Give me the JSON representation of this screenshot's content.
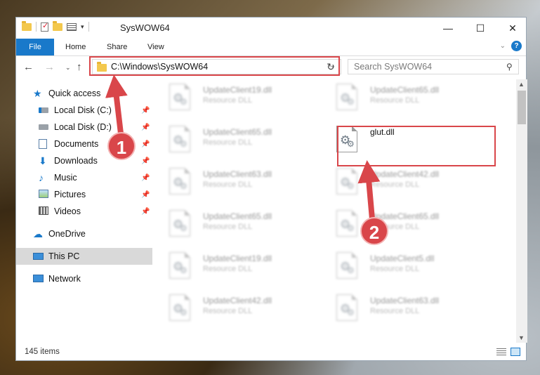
{
  "window": {
    "title": "SysWOW64",
    "controls": {
      "minimize": "—",
      "maximize": "☐",
      "close": "✕"
    }
  },
  "ribbon": {
    "tabs": [
      "File",
      "Home",
      "Share",
      "View"
    ],
    "help": "?"
  },
  "address": {
    "path": "C:\\Windows\\SysWOW64",
    "search_placeholder": "Search SysWOW64"
  },
  "sidebar": {
    "items": [
      {
        "label": "Quick access",
        "icon": "star-icon"
      },
      {
        "label": "Local Disk (C:)",
        "icon": "drive-icon",
        "pinned": true
      },
      {
        "label": "Local Disk (D:)",
        "icon": "drive-icon",
        "pinned": true
      },
      {
        "label": "Documents",
        "icon": "documents-icon",
        "pinned": true
      },
      {
        "label": "Downloads",
        "icon": "download-icon",
        "pinned": true
      },
      {
        "label": "Music",
        "icon": "music-icon",
        "pinned": true
      },
      {
        "label": "Pictures",
        "icon": "pictures-icon",
        "pinned": true
      },
      {
        "label": "Videos",
        "icon": "videos-icon",
        "pinned": true
      },
      {
        "label": "OneDrive",
        "icon": "cloud-icon"
      },
      {
        "label": "This PC",
        "icon": "computer-icon",
        "selected": true
      },
      {
        "label": "Network",
        "icon": "network-icon"
      }
    ]
  },
  "files": [
    {
      "name": "UpdateClient19.dll",
      "type": "Resource DLL"
    },
    {
      "name": "UpdateClient65.dll",
      "type": "Resource DLL"
    },
    {
      "name": "UpdateClient65.dll",
      "type": "Resource DLL"
    },
    {
      "name": "glut.dll",
      "type": ""
    },
    {
      "name": "UpdateClient63.dll",
      "type": "Resource DLL"
    },
    {
      "name": "UpdateClient42.dll",
      "type": "Resource DLL"
    },
    {
      "name": "UpdateClient65.dll",
      "type": "Resource DLL"
    },
    {
      "name": "UpdateClient65.dll",
      "type": "Resource DLL"
    },
    {
      "name": "UpdateClient19.dll",
      "type": "Resource DLL"
    },
    {
      "name": "UpdateClient5.dll",
      "type": "Resource DLL"
    },
    {
      "name": "UpdateClient42.dll",
      "type": "Resource DLL"
    },
    {
      "name": "UpdateClient63.dll",
      "type": "Resource DLL"
    }
  ],
  "status": {
    "item_count": "145 items"
  },
  "callouts": [
    "1",
    "2"
  ],
  "colors": {
    "accent": "#1979ca",
    "highlight": "#d9464a"
  }
}
